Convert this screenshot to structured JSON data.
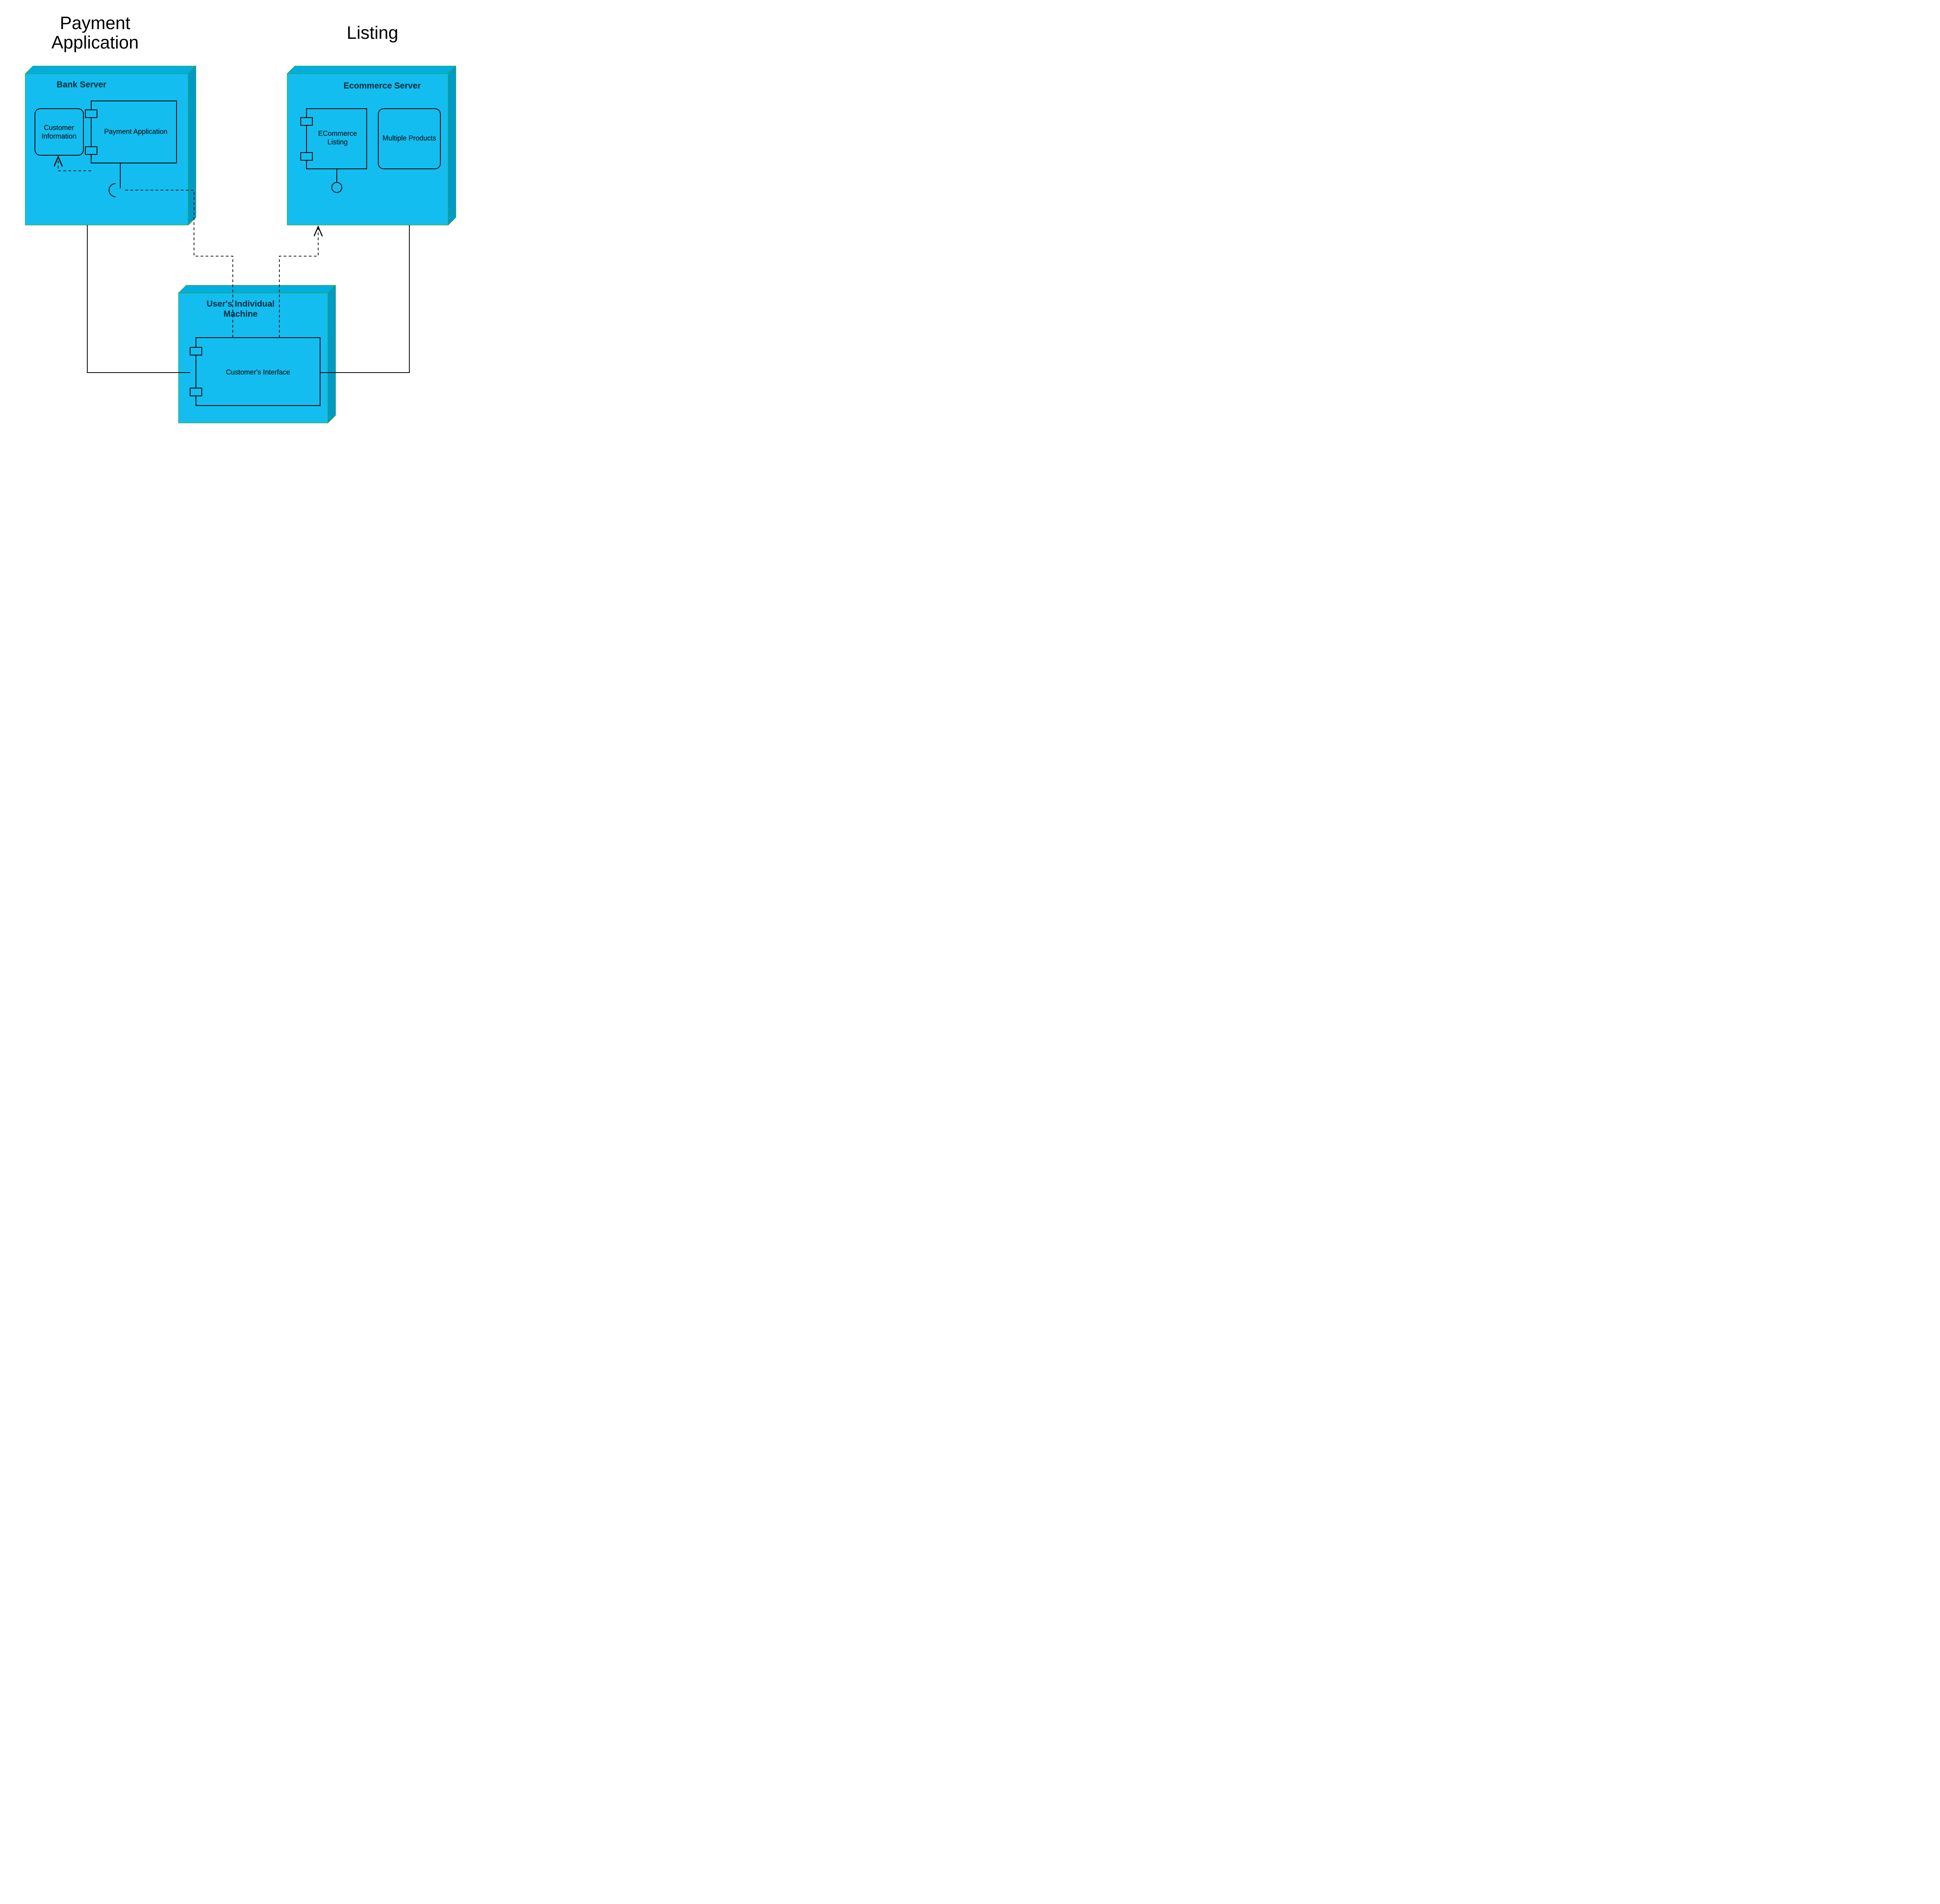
{
  "externalTitles": {
    "left1": "Payment",
    "left2": "Application",
    "right": "Listing"
  },
  "nodes": {
    "bank": {
      "title": "Bank Server",
      "custInfo": "Customer\nInformation",
      "paymentApp": "Payment Application"
    },
    "ecom": {
      "title": "Ecommerce Server",
      "listing": "ECommerce\nListing",
      "products": "Multiple Products"
    },
    "user": {
      "title": "User's Individual\nMachine",
      "interface": "Customer's Interface"
    }
  }
}
